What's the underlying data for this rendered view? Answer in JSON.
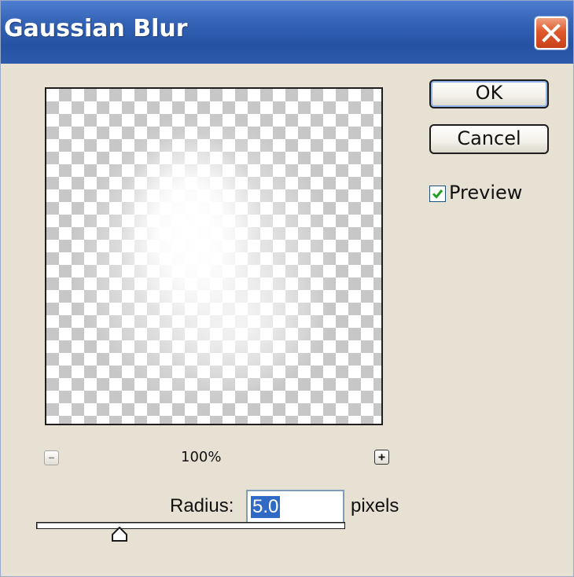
{
  "window": {
    "title": "Gaussian Blur",
    "close_icon": "close-icon"
  },
  "buttons": {
    "ok_label": "OK",
    "cancel_label": "Cancel"
  },
  "preview": {
    "label": "Preview",
    "checked": true
  },
  "zoom": {
    "level": "100%",
    "zoom_out_icon": "minus-icon",
    "zoom_in_icon": "plus-icon"
  },
  "radius": {
    "label": "Radius:",
    "value": "5.0",
    "unit": "pixels",
    "slider_fraction": 0.27
  },
  "colors": {
    "title_bar": "#2d5aab",
    "dialog_bg": "#e6e1d2",
    "close_button": "#de5a2c",
    "selection": "#316ac5",
    "checkmark": "#21a121"
  }
}
